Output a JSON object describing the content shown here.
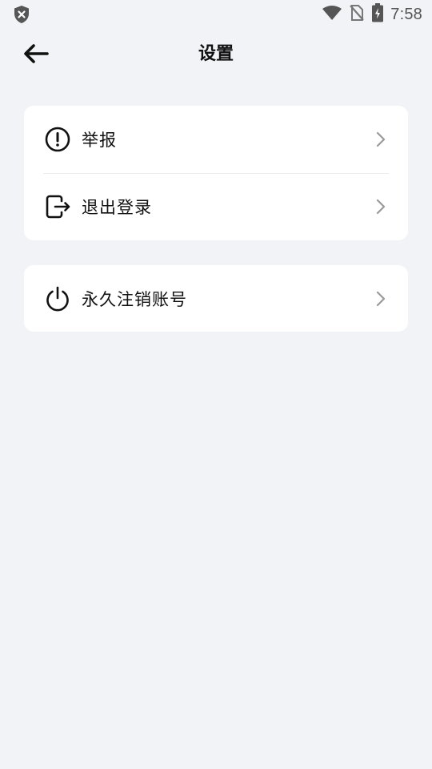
{
  "status_bar": {
    "time": "7:58",
    "icons": [
      "shield-icon",
      "wifi-icon",
      "no-sim-icon",
      "battery-charging-icon"
    ]
  },
  "header": {
    "title": "设置",
    "back_icon": "arrow-left-icon"
  },
  "settings": {
    "group1": [
      {
        "label": "举报",
        "icon": "alert-circle-icon"
      },
      {
        "label": "退出登录",
        "icon": "logout-icon"
      }
    ],
    "group2": [
      {
        "label": "永久注销账号",
        "icon": "power-icon"
      }
    ]
  },
  "colors": {
    "background": "#f2f3f7",
    "card": "#ffffff",
    "text": "#111111",
    "chevron": "#9a9a9a"
  }
}
